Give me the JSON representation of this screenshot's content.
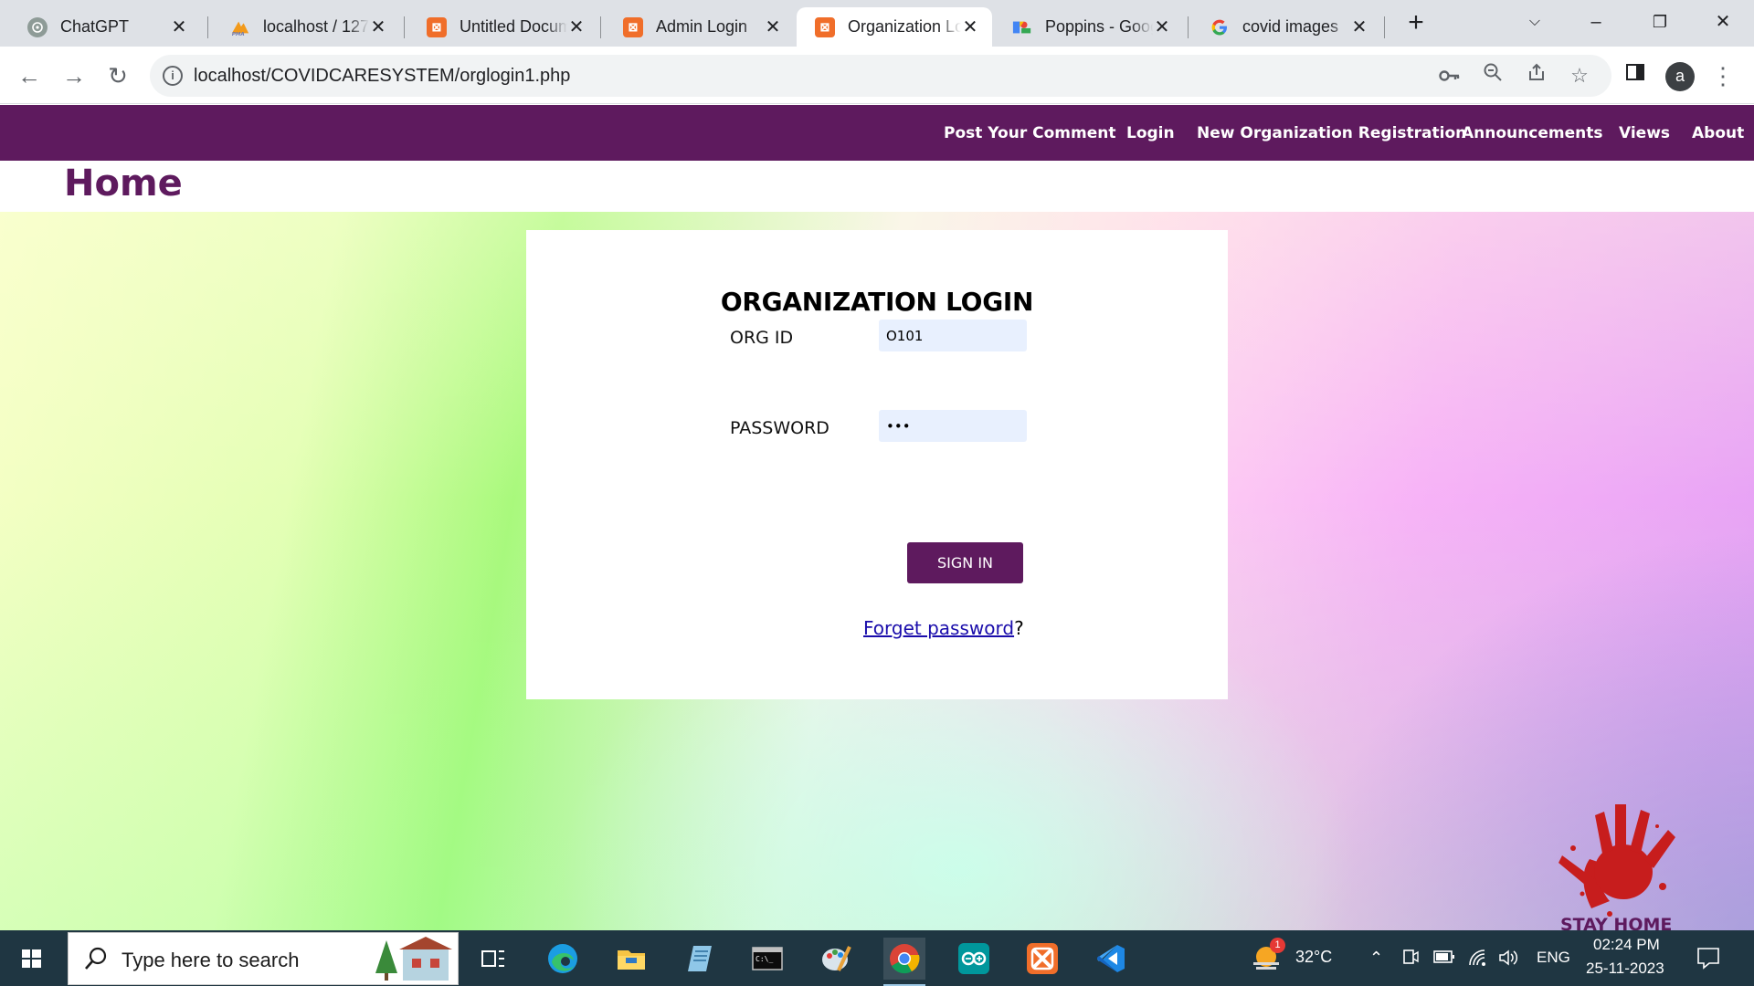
{
  "browser": {
    "tabs": [
      {
        "title": "ChatGPT",
        "icon": "chatgpt-icon"
      },
      {
        "title": "localhost / 127.0.0.1",
        "icon": "phpmyadmin-icon"
      },
      {
        "title": "Untitled Document",
        "icon": "xampp-icon"
      },
      {
        "title": "Admin Login",
        "icon": "xampp-icon"
      },
      {
        "title": "Organization Login",
        "icon": "xampp-icon",
        "active": true
      },
      {
        "title": "Poppins - Google Fonts",
        "icon": "google-fonts-icon"
      },
      {
        "title": "covid images",
        "icon": "google-icon"
      }
    ],
    "url": "localhost/COVIDCARESYSTEM/orglogin1.php",
    "profile_initial": "a"
  },
  "nav": {
    "links": [
      "Post Your Comment",
      "Login",
      "New Organization Registration",
      "Announcements",
      "Views",
      "About"
    ]
  },
  "page": {
    "heading": "Home"
  },
  "login": {
    "title": "ORGANIZATION LOGIN",
    "org_id_label": "ORG ID",
    "org_id_value": "O101",
    "password_label": "PASSWORD",
    "password_value": "•••",
    "submit_label": "SIGN IN",
    "forget_link": "Forget password",
    "forget_suffix": "?"
  },
  "decor": {
    "stay_home_text": "STAY HOME"
  },
  "taskbar": {
    "search_placeholder": "Type here to search",
    "weather": "32°C",
    "weather_badge": "1",
    "language": "ENG",
    "time": "02:24 PM",
    "date": "25-11-2023"
  },
  "colors": {
    "brand": "#5e1a5e",
    "input_bg": "#e8f0fe",
    "link": "#1a0dab"
  }
}
